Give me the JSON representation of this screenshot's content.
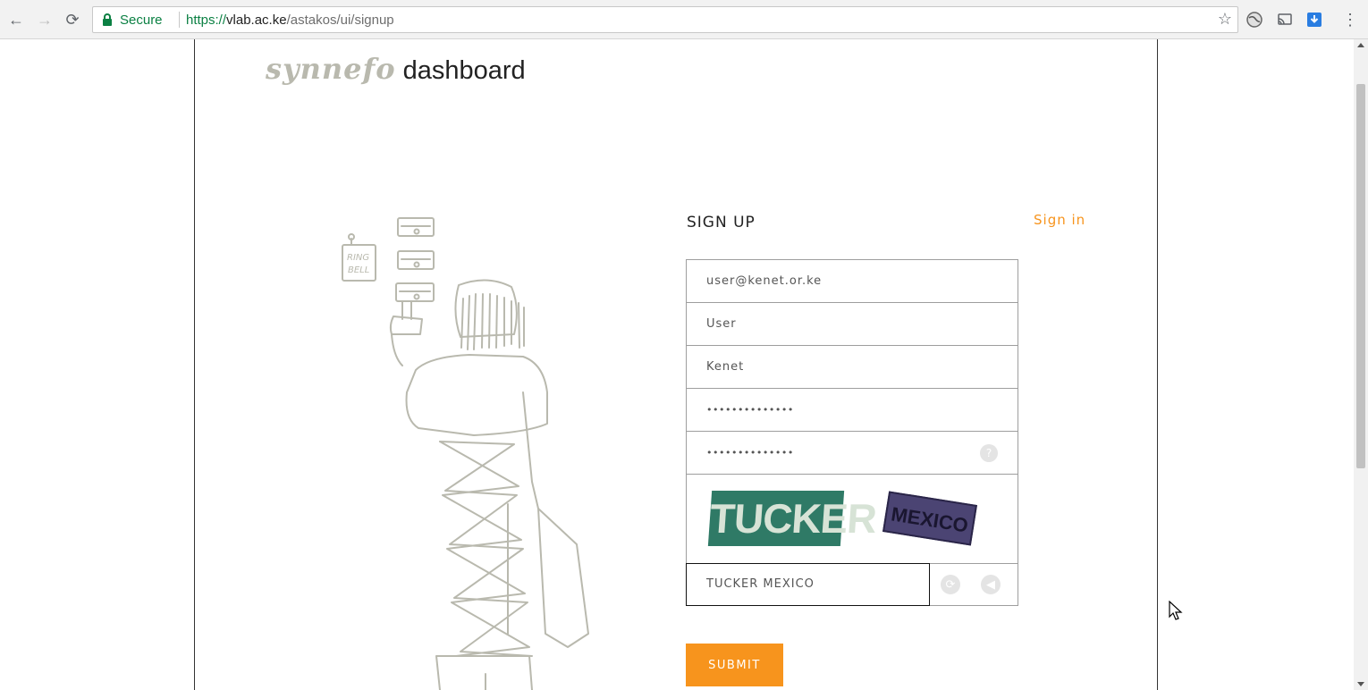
{
  "browser": {
    "secure_label": "Secure",
    "url_scheme": "https://",
    "url_host": "vlab.ac.ke",
    "url_path": "/astakos/ui/signup"
  },
  "brand": {
    "logo_mark": "synnefo",
    "logo_text": "dashboard"
  },
  "signup": {
    "title": "SIGN UP",
    "signin_link": "Sign in",
    "email_value": "user@kenet.or.ke",
    "first_name_value": "User",
    "last_name_value": "Kenet",
    "password_value": "••••••••••••••",
    "password_confirm_value": "••••••••••••••",
    "captcha_word_1": "TUCKER",
    "captcha_word_2": "MEXICO",
    "captcha_value": "TUCKER MEXICO",
    "submit_label": "SUBMIT"
  },
  "colors": {
    "accent": "#f7941d",
    "secure_green": "#0b8043",
    "border": "#9e9e9e"
  }
}
